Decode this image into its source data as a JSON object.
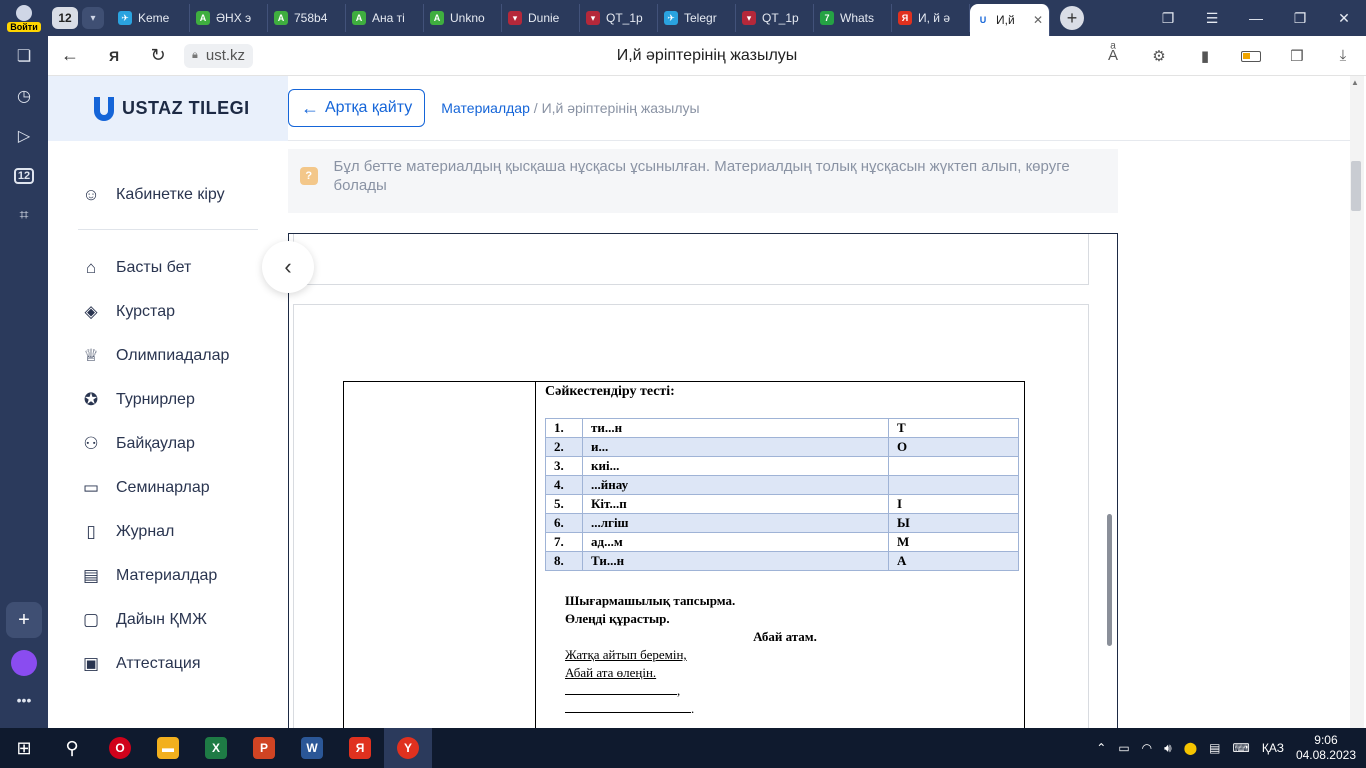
{
  "tabbar": {
    "profile_label": "Войти",
    "tab_count": "12",
    "tabs": [
      {
        "label": "Keme",
        "color": "#2aa3e0",
        "glyph": "✈"
      },
      {
        "label": "ӘНХ э",
        "color": "#3fae3f",
        "glyph": "A"
      },
      {
        "label": "758b4",
        "color": "#3fae3f",
        "glyph": "A"
      },
      {
        "label": "Ана ті",
        "color": "#3fae3f",
        "glyph": "A"
      },
      {
        "label": "Unkno",
        "color": "#3fae3f",
        "glyph": "A"
      },
      {
        "label": "Dunie",
        "color": "#b5283a",
        "glyph": "▾"
      },
      {
        "label": "QT_1p",
        "color": "#b5283a",
        "glyph": "▾"
      },
      {
        "label": "Telegr",
        "color": "#2aa3e0",
        "glyph": "✈"
      },
      {
        "label": "QT_1p",
        "color": "#b5283a",
        "glyph": "▾"
      },
      {
        "label": "Whats",
        "color": "#25a244",
        "glyph": "7"
      },
      {
        "label": "И, й ә",
        "color": "#e0311f",
        "glyph": "Я"
      }
    ],
    "active_tab": {
      "label": "И,й",
      "color": "#1565d8",
      "glyph": "U"
    }
  },
  "address": {
    "domain": "ust.kz",
    "title": "И,й әріптерінің жазылуы"
  },
  "site": {
    "logo_text": "USTAZ TILEGI",
    "account": "Кабинетке кіру",
    "menu": [
      {
        "label": "Басты бет",
        "icon": "⌂",
        "name": "home"
      },
      {
        "label": "Курстар",
        "icon": "◈",
        "name": "courses"
      },
      {
        "label": "Олимпиадалар",
        "icon": "♕",
        "name": "olympiads"
      },
      {
        "label": "Турнирлер",
        "icon": "✪",
        "name": "tournaments"
      },
      {
        "label": "Байқаулар",
        "icon": "⚇",
        "name": "contests"
      },
      {
        "label": "Семинарлар",
        "icon": "▭",
        "name": "seminars"
      },
      {
        "label": "Журнал",
        "icon": "▯",
        "name": "journal"
      },
      {
        "label": "Материалдар",
        "icon": "▤",
        "name": "materials"
      },
      {
        "label": "Дайын ҚМЖ",
        "icon": "▢",
        "name": "ready-kmzh"
      },
      {
        "label": "Аттестация",
        "icon": "▣",
        "name": "attestation"
      }
    ]
  },
  "content": {
    "back_label": "Артқа қайту",
    "crumb_link": "Материалдар",
    "crumb_sep": " / ",
    "crumb_current": "И,й әріптерінің жазылуы",
    "notice": "Бұл бетте материалдың қысқаша нұсқасы ұсынылған. Материалдың толық нұсқасын жүктеп алып, көруге болады"
  },
  "document": {
    "heading": "Сәйкестендіру тесті:",
    "rows": [
      [
        "1.",
        "ти...н",
        "Т"
      ],
      [
        "2.",
        "и...",
        "О"
      ],
      [
        "3.",
        "киі...",
        ""
      ],
      [
        "4.",
        "...йнау",
        ""
      ],
      [
        "5.",
        "Кіт...п",
        "І"
      ],
      [
        "6.",
        "...лгіш",
        "Ы"
      ],
      [
        "7.",
        "ад...м",
        "М"
      ],
      [
        "8.",
        "Ти...н",
        "А"
      ]
    ],
    "task_title": "Шығармашылық тапсырма.",
    "task_sub": "Өлеңді құрастыр.",
    "poem_title": "Абай атам.",
    "poem_line1": "Жатқа айтып беремін,",
    "poem_line2": "Абай ата өлеңін.",
    "blank_end1": ",",
    "blank_end2": "."
  },
  "taskbar": {
    "lang": "ҚАЗ",
    "time": "9:06",
    "date": "04.08.2023"
  }
}
